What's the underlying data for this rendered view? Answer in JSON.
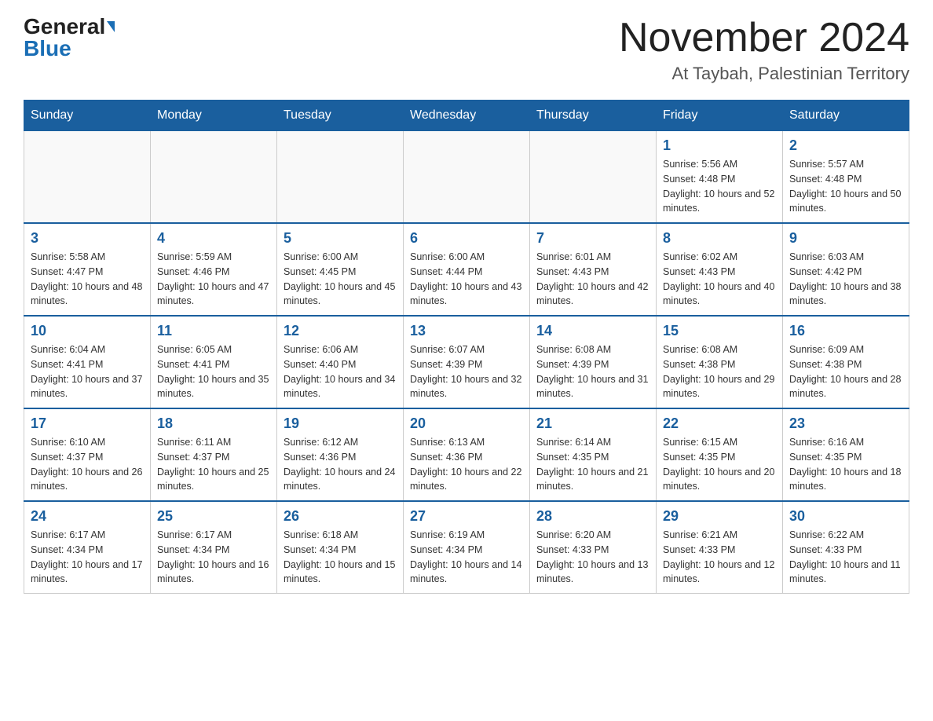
{
  "header": {
    "logo_general": "General",
    "logo_blue": "Blue",
    "month_title": "November 2024",
    "location": "At Taybah, Palestinian Territory"
  },
  "weekdays": [
    "Sunday",
    "Monday",
    "Tuesday",
    "Wednesday",
    "Thursday",
    "Friday",
    "Saturday"
  ],
  "weeks": [
    [
      {
        "day": "",
        "info": ""
      },
      {
        "day": "",
        "info": ""
      },
      {
        "day": "",
        "info": ""
      },
      {
        "day": "",
        "info": ""
      },
      {
        "day": "",
        "info": ""
      },
      {
        "day": "1",
        "info": "Sunrise: 5:56 AM\nSunset: 4:48 PM\nDaylight: 10 hours and 52 minutes."
      },
      {
        "day": "2",
        "info": "Sunrise: 5:57 AM\nSunset: 4:48 PM\nDaylight: 10 hours and 50 minutes."
      }
    ],
    [
      {
        "day": "3",
        "info": "Sunrise: 5:58 AM\nSunset: 4:47 PM\nDaylight: 10 hours and 48 minutes."
      },
      {
        "day": "4",
        "info": "Sunrise: 5:59 AM\nSunset: 4:46 PM\nDaylight: 10 hours and 47 minutes."
      },
      {
        "day": "5",
        "info": "Sunrise: 6:00 AM\nSunset: 4:45 PM\nDaylight: 10 hours and 45 minutes."
      },
      {
        "day": "6",
        "info": "Sunrise: 6:00 AM\nSunset: 4:44 PM\nDaylight: 10 hours and 43 minutes."
      },
      {
        "day": "7",
        "info": "Sunrise: 6:01 AM\nSunset: 4:43 PM\nDaylight: 10 hours and 42 minutes."
      },
      {
        "day": "8",
        "info": "Sunrise: 6:02 AM\nSunset: 4:43 PM\nDaylight: 10 hours and 40 minutes."
      },
      {
        "day": "9",
        "info": "Sunrise: 6:03 AM\nSunset: 4:42 PM\nDaylight: 10 hours and 38 minutes."
      }
    ],
    [
      {
        "day": "10",
        "info": "Sunrise: 6:04 AM\nSunset: 4:41 PM\nDaylight: 10 hours and 37 minutes."
      },
      {
        "day": "11",
        "info": "Sunrise: 6:05 AM\nSunset: 4:41 PM\nDaylight: 10 hours and 35 minutes."
      },
      {
        "day": "12",
        "info": "Sunrise: 6:06 AM\nSunset: 4:40 PM\nDaylight: 10 hours and 34 minutes."
      },
      {
        "day": "13",
        "info": "Sunrise: 6:07 AM\nSunset: 4:39 PM\nDaylight: 10 hours and 32 minutes."
      },
      {
        "day": "14",
        "info": "Sunrise: 6:08 AM\nSunset: 4:39 PM\nDaylight: 10 hours and 31 minutes."
      },
      {
        "day": "15",
        "info": "Sunrise: 6:08 AM\nSunset: 4:38 PM\nDaylight: 10 hours and 29 minutes."
      },
      {
        "day": "16",
        "info": "Sunrise: 6:09 AM\nSunset: 4:38 PM\nDaylight: 10 hours and 28 minutes."
      }
    ],
    [
      {
        "day": "17",
        "info": "Sunrise: 6:10 AM\nSunset: 4:37 PM\nDaylight: 10 hours and 26 minutes."
      },
      {
        "day": "18",
        "info": "Sunrise: 6:11 AM\nSunset: 4:37 PM\nDaylight: 10 hours and 25 minutes."
      },
      {
        "day": "19",
        "info": "Sunrise: 6:12 AM\nSunset: 4:36 PM\nDaylight: 10 hours and 24 minutes."
      },
      {
        "day": "20",
        "info": "Sunrise: 6:13 AM\nSunset: 4:36 PM\nDaylight: 10 hours and 22 minutes."
      },
      {
        "day": "21",
        "info": "Sunrise: 6:14 AM\nSunset: 4:35 PM\nDaylight: 10 hours and 21 minutes."
      },
      {
        "day": "22",
        "info": "Sunrise: 6:15 AM\nSunset: 4:35 PM\nDaylight: 10 hours and 20 minutes."
      },
      {
        "day": "23",
        "info": "Sunrise: 6:16 AM\nSunset: 4:35 PM\nDaylight: 10 hours and 18 minutes."
      }
    ],
    [
      {
        "day": "24",
        "info": "Sunrise: 6:17 AM\nSunset: 4:34 PM\nDaylight: 10 hours and 17 minutes."
      },
      {
        "day": "25",
        "info": "Sunrise: 6:17 AM\nSunset: 4:34 PM\nDaylight: 10 hours and 16 minutes."
      },
      {
        "day": "26",
        "info": "Sunrise: 6:18 AM\nSunset: 4:34 PM\nDaylight: 10 hours and 15 minutes."
      },
      {
        "day": "27",
        "info": "Sunrise: 6:19 AM\nSunset: 4:34 PM\nDaylight: 10 hours and 14 minutes."
      },
      {
        "day": "28",
        "info": "Sunrise: 6:20 AM\nSunset: 4:33 PM\nDaylight: 10 hours and 13 minutes."
      },
      {
        "day": "29",
        "info": "Sunrise: 6:21 AM\nSunset: 4:33 PM\nDaylight: 10 hours and 12 minutes."
      },
      {
        "day": "30",
        "info": "Sunrise: 6:22 AM\nSunset: 4:33 PM\nDaylight: 10 hours and 11 minutes."
      }
    ]
  ]
}
